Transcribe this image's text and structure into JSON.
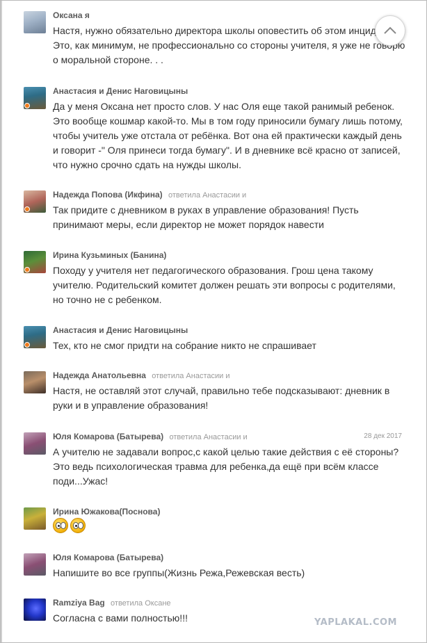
{
  "comments": [
    {
      "author": "Оксана я",
      "reply_to": "",
      "date": "",
      "text": "Настя, нужно обязательно  директора школы оповестить об этом инциденте ! Это,  как минимум, не профессионально со стороны учителя, я уже не говорю о моральной стороне. . ."
    },
    {
      "author": "Анастасия и Денис Наговицыны",
      "reply_to": "",
      "date": "",
      "text": "Да у меня Оксана нет просто слов. У нас Оля еще такой ранимый ребенок. Это вообще кошмар какой-то. Мы в том году приносили бумагу лишь потому, чтобы учитель уже отстала от ребёнка. Вот она ей практически каждый день и говорит -\" Оля принеси тогда бумагу\". И в дневнике всё красно от записей, что нужно срочно сдать на нужды школы."
    },
    {
      "author": "Надежда Попова (Икфина)",
      "reply_to": "ответила Анастасии и",
      "date": "",
      "text": "Так придите с дневником в руках в управление образования! Пусть принимают меры, если директор не может порядок навести"
    },
    {
      "author": "Ирина Кузьминых (Банина)",
      "reply_to": "",
      "date": "",
      "text": "Походу у учителя нет педагогического образования. Грош цена такому учителю. Родительский комитет должен решать эти вопросы с родителями, но точно не с ребенком."
    },
    {
      "author": "Анастасия и Денис Наговицыны",
      "reply_to": "",
      "date": "",
      "text": "Тех, кто не смог придти на собрание никто не спрашивает"
    },
    {
      "author": "Надежда Анатольевна",
      "reply_to": "ответила Анастасии и",
      "date": "",
      "text": "Настя, не оставляй этот случай, правильно тебе подсказывают: дневник в руки и в управление образования!"
    },
    {
      "author": "Юля Комарова (Батырева)",
      "reply_to": "ответила Анастасии и",
      "date": "28 дек 2017",
      "text": "А учителю не задавали вопрос,с какой целью такие действия с её стороны?Это ведь психологическая травма для ребенка,да ещё при всём классе поди...Ужас!"
    },
    {
      "author": "Ирина Южакова(Поснова)",
      "reply_to": "",
      "date": "",
      "text": ""
    },
    {
      "author": "Юля Комарова (Батырева)",
      "reply_to": "",
      "date": "",
      "text": "Напишите во все группы(Жизнь Режа,Режевская весть)"
    },
    {
      "author": "Ramziya Bag",
      "reply_to": "ответила Оксане",
      "date": "",
      "text": "Согласна с вами полностью!!!"
    }
  ],
  "emojis": [
    "eyes-emoji",
    "eyes-emoji"
  ],
  "watermark": "YAPLAKAL.COM",
  "colors": {
    "author": "#5a5a5a",
    "text": "#333333",
    "meta": "#999999",
    "online_dot": "#f07b1b",
    "watermark": "#b4bcc7"
  },
  "icons": {
    "scroll_top": "chevron-up-icon"
  }
}
